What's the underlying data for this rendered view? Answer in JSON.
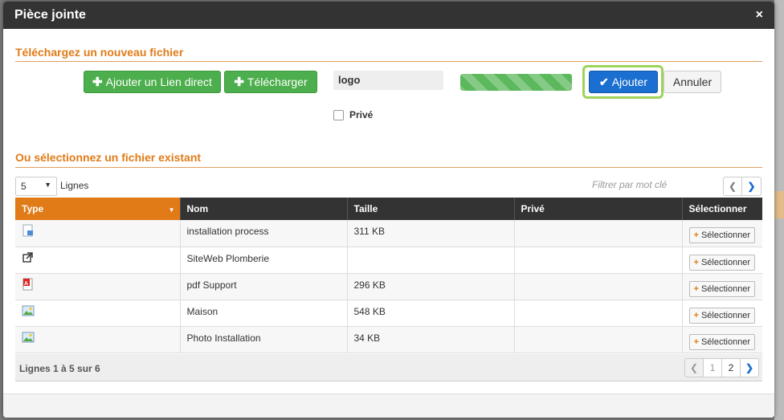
{
  "modal": {
    "title": "Pièce jointe",
    "close_label": "×"
  },
  "upload": {
    "section_title": "Téléchargez un nouveau fichier",
    "add_link_label": "Ajouter un Lien direct",
    "upload_label": "Télécharger",
    "filename_value": "logo",
    "progress": 1.0,
    "add_label": "Ajouter",
    "cancel_label": "Annuler",
    "private_label": "Privé",
    "private_checked": false
  },
  "existing": {
    "section_title": "Ou sélectionnez un fichier existant",
    "lines_value": "5",
    "lines_label": "Lignes",
    "filter_placeholder": "Filtrer par mot clé",
    "columns": [
      "Type",
      "Nom",
      "Taille",
      "Privé",
      "Sélectionner"
    ],
    "rows": [
      {
        "type_icon": "document-icon",
        "name": "installation process",
        "size": "311 KB",
        "private": "",
        "select_label": "Sélectionner"
      },
      {
        "type_icon": "external-link-icon",
        "name": "SiteWeb Plomberie",
        "size": "",
        "private": "",
        "select_label": "Sélectionner"
      },
      {
        "type_icon": "pdf-icon",
        "name": "pdf Support",
        "size": "296 KB",
        "private": "",
        "select_label": "Sélectionner"
      },
      {
        "type_icon": "image-icon",
        "name": "Maison",
        "size": "548 KB",
        "private": "",
        "select_label": "Sélectionner"
      },
      {
        "type_icon": "image-icon",
        "name": "Photo Installation",
        "size": "34 KB",
        "private": "",
        "select_label": "Sélectionner"
      }
    ],
    "footer_text": "Lignes 1 à 5 sur 6",
    "pages": [
      "1",
      "2"
    ]
  },
  "colors": {
    "accent": "#e07b18",
    "green": "#4cae4c",
    "blue": "#1a6fd1",
    "header": "#333333"
  }
}
